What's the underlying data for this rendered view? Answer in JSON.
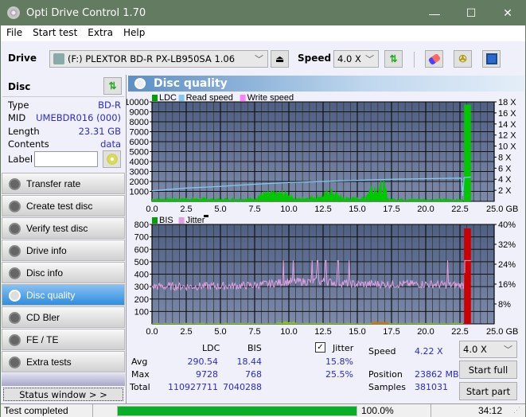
{
  "window": {
    "title": "Opti Drive Control 1.70",
    "minimize": "—",
    "maximize": "☐",
    "close": "✕"
  },
  "menu": [
    "File",
    "Start test",
    "Extra",
    "Help"
  ],
  "toolbar": {
    "drive_label": "Drive",
    "drive_value": "(F:)  PLEXTOR BD-R  PX-LB950SA 1.06",
    "speed_label": "Speed",
    "speed_value": "4.0 X"
  },
  "disc": {
    "header": "Disc",
    "type_label": "Type",
    "type": "BD-R",
    "mid_label": "MID",
    "mid": "UMEBDR016 (000)",
    "length_label": "Length",
    "length": "23.31 GB",
    "contents_label": "Contents",
    "contents": "data",
    "label_label": "Label",
    "label_value": ""
  },
  "nav": [
    {
      "label": "Transfer rate"
    },
    {
      "label": "Create test disc"
    },
    {
      "label": "Verify test disc"
    },
    {
      "label": "Drive info"
    },
    {
      "label": "Disc info"
    },
    {
      "label": "Disc quality",
      "active": true
    },
    {
      "label": "CD Bler"
    },
    {
      "label": "FE / TE"
    },
    {
      "label": "Extra tests"
    }
  ],
  "status_window_btn": "Status window > >",
  "panel": {
    "title": "Disc quality"
  },
  "chart_data": [
    {
      "type": "area",
      "title": "LDC / Read speed",
      "legend": [
        "LDC",
        "Read speed",
        "Write speed"
      ],
      "legend_colors": [
        "#00a000",
        "#80c8f0",
        "#ff80ff"
      ],
      "xlabel": "GB",
      "xlim": [
        0,
        25
      ],
      "x_ticks": [
        "0.0",
        "2.5",
        "5.0",
        "7.5",
        "10.0",
        "12.5",
        "15.0",
        "17.5",
        "20.0",
        "22.5",
        "25.0 GB"
      ],
      "ylim": [
        0,
        10000
      ],
      "y_ticks": [
        "1000",
        "2000",
        "3000",
        "4000",
        "5000",
        "6000",
        "7000",
        "8000",
        "9000",
        "10000"
      ],
      "y2lim": [
        0,
        18
      ],
      "y2_ticks": [
        "2 X",
        "4 X",
        "6 X",
        "8 X",
        "10 X",
        "12 X",
        "14 X",
        "16 X",
        "18 X"
      ],
      "ldc_profile": [
        {
          "x": 0,
          "y": 300
        },
        {
          "x": 2.5,
          "y": 350
        },
        {
          "x": 5,
          "y": 300
        },
        {
          "x": 7.5,
          "y": 350
        },
        {
          "x": 8,
          "y": 900
        },
        {
          "x": 10,
          "y": 1000
        },
        {
          "x": 10.5,
          "y": 300
        },
        {
          "x": 12.5,
          "y": 700
        },
        {
          "x": 13,
          "y": 1300
        },
        {
          "x": 14,
          "y": 400
        },
        {
          "x": 15.5,
          "y": 400
        },
        {
          "x": 16,
          "y": 1700
        },
        {
          "x": 17,
          "y": 1700
        },
        {
          "x": 17.3,
          "y": 300
        },
        {
          "x": 20,
          "y": 250
        },
        {
          "x": 22.7,
          "y": 250
        },
        {
          "x": 22.8,
          "y": 9728
        },
        {
          "x": 23.3,
          "y": 9728
        }
      ],
      "read_speed": [
        {
          "x": 0,
          "y": 1.9
        },
        {
          "x": 2.5,
          "y": 2.4
        },
        {
          "x": 5,
          "y": 2.7
        },
        {
          "x": 7.5,
          "y": 3.1
        },
        {
          "x": 10,
          "y": 3.4
        },
        {
          "x": 12.5,
          "y": 3.6
        },
        {
          "x": 15,
          "y": 3.8
        },
        {
          "x": 17.5,
          "y": 4.0
        },
        {
          "x": 20,
          "y": 4.1
        },
        {
          "x": 22.6,
          "y": 4.2
        },
        {
          "x": 22.7,
          "y": 1.0
        },
        {
          "x": 22.8,
          "y": 4.3
        },
        {
          "x": 23.3,
          "y": 4.4
        }
      ]
    },
    {
      "type": "line",
      "title": "BIS / Jitter",
      "legend": [
        "BIS",
        "Jitter"
      ],
      "legend_colors": [
        "#00a000",
        "#e0a0e0"
      ],
      "xlabel": "GB",
      "xlim": [
        0,
        25
      ],
      "x_ticks": [
        "0.0",
        "2.5",
        "5.0",
        "7.5",
        "10.0",
        "12.5",
        "15.0",
        "17.5",
        "20.0",
        "22.5",
        "25.0 GB"
      ],
      "ylim": [
        0,
        800
      ],
      "y_ticks": [
        "100",
        "200",
        "300",
        "400",
        "500",
        "600",
        "700",
        "800"
      ],
      "y2lim": [
        0,
        40
      ],
      "y2_ticks": [
        "8%",
        "16%",
        "24%",
        "32%",
        "40%"
      ],
      "jitter_profile": [
        {
          "x": 0,
          "y": 15.0
        },
        {
          "x": 5,
          "y": 15.2
        },
        {
          "x": 7.5,
          "y": 15.5
        },
        {
          "x": 10,
          "y": 17
        },
        {
          "x": 12.5,
          "y": 17
        },
        {
          "x": 15,
          "y": 16
        },
        {
          "x": 20,
          "y": 16
        },
        {
          "x": 22.7,
          "y": 15.5
        },
        {
          "x": 22.8,
          "y": 25.5
        },
        {
          "x": 23.3,
          "y": 25.5
        }
      ],
      "jitter_spikes": [
        {
          "x": 9.6,
          "y": 25.5
        },
        {
          "x": 10.3,
          "y": 25.5
        },
        {
          "x": 11.7,
          "y": 25.5
        },
        {
          "x": 12.1,
          "y": 25.5
        },
        {
          "x": 12.7,
          "y": 25.5
        },
        {
          "x": 13.6,
          "y": 25.5
        },
        {
          "x": 14.4,
          "y": 25.5
        },
        {
          "x": 21.6,
          "y": 25.5
        }
      ],
      "bis_max_block": {
        "x0": 22.8,
        "x1": 23.3,
        "y": 768
      }
    }
  ],
  "stats": {
    "col_ldc": "LDC",
    "col_bis": "BIS",
    "jitter_label": "Jitter",
    "jitter_checked": true,
    "avg_label": "Avg",
    "avg_ldc": "290.54",
    "avg_bis": "18.44",
    "avg_jitter": "15.8%",
    "max_label": "Max",
    "max_ldc": "9728",
    "max_bis": "768",
    "max_jitter": "25.5%",
    "total_label": "Total",
    "total_ldc": "110927711",
    "total_bis": "7040288",
    "speed_label": "Speed",
    "speed_value": "4.22 X",
    "position_label": "Position",
    "position_value": "23862 MB",
    "samples_label": "Samples",
    "samples_value": "381031",
    "speed_select": "4.0 X",
    "start_full": "Start full",
    "start_part": "Start part"
  },
  "status": {
    "text": "Test completed",
    "progress": 100.0,
    "progress_label": "100.0%",
    "time": "34:12"
  }
}
